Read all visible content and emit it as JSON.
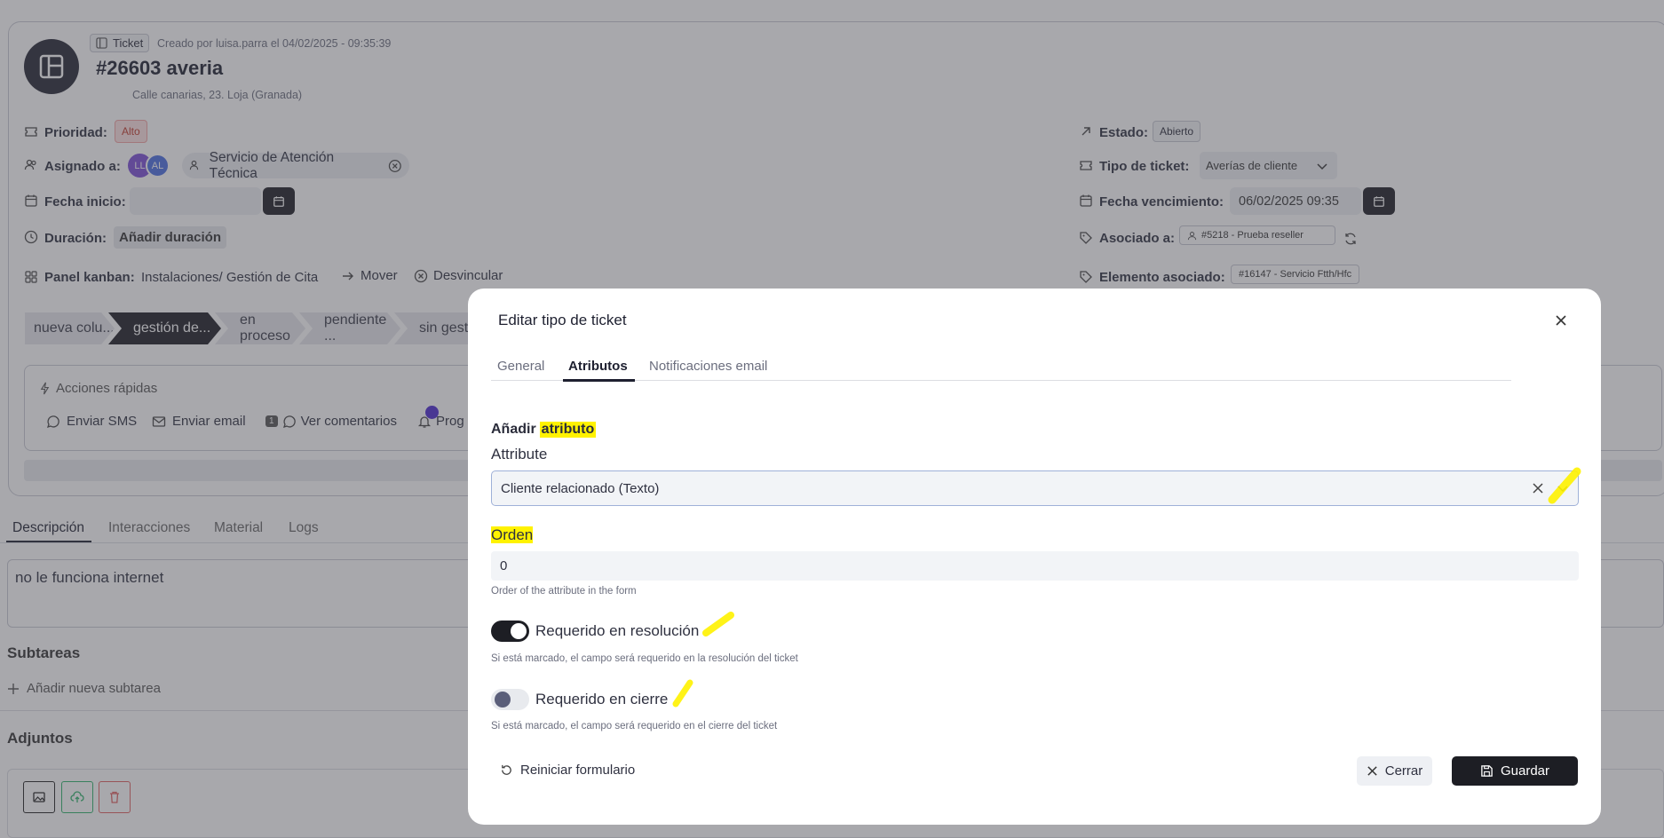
{
  "ticket": {
    "type_badge": "Ticket",
    "created_by": "Creado por luisa.parra el 04/02/2025 - 09:35:39",
    "title": "#26603 averia",
    "address": "Calle canarias, 23. Loja (Granada)",
    "priority_label": "Prioridad:",
    "priority_value": "Alto",
    "assigned_label": "Asignado a:",
    "avatar1": "LL",
    "avatar2": "AL",
    "assigned_group": "Servicio de Atención Técnica",
    "start_label": "Fecha inicio:",
    "duration_label": "Duración:",
    "duration_value": "Añadir duración",
    "kanban_label": "Panel kanban:",
    "kanban_value": "Instalaciones/ Gestión de Cita",
    "move_label": "Mover",
    "unlink_label": "Desvincular",
    "status_label": "Estado:",
    "status_value": "Abierto",
    "type_label": "Tipo de ticket:",
    "type_value": "Averías de cliente",
    "due_label": "Fecha vencimiento:",
    "due_value": "06/02/2025 09:35",
    "associated_label": "Asociado a:",
    "associated_value": "#5218 - Prueba reseller",
    "element_label": "Elemento asociado:",
    "element_value": "#16147 - Servicio Ftth/Hfc"
  },
  "stages": [
    "nueva colu...",
    "gestión de...",
    "en proceso",
    "pendiente ...",
    "sin gestio"
  ],
  "quick_actions": {
    "title": "Acciones rápidas",
    "sms": "Enviar SMS",
    "email": "Enviar email",
    "comments_count": "1",
    "comments": "Ver comentarios",
    "prog": "Prog"
  },
  "detail_tabs": [
    "Descripción",
    "Interacciones",
    "Material",
    "Logs"
  ],
  "description": "no le funciona internet",
  "subtasks": {
    "title": "Subtareas",
    "add": "Añadir nueva subtarea"
  },
  "attachments": {
    "title": "Adjuntos"
  },
  "modal": {
    "title": "Editar tipo de ticket",
    "tabs": [
      "General",
      "Atributos",
      "Notificaciones email"
    ],
    "section_title_1": "Añadir",
    "section_title_2": "atributo",
    "attribute_label": "Attribute",
    "attribute_value": "Cliente relacionado (Texto)",
    "order_label": "Orden",
    "order_value": "0",
    "order_help": "Order of the attribute in the form",
    "toggle1_label": "Requerido en resolución",
    "toggle1_help": "Si está marcado, el campo será requerido en la resolución del ticket",
    "toggle2_label": "Requerido en cierre",
    "toggle2_help": "Si está marcado, el campo será requerido en el cierre del ticket",
    "reset": "Reiniciar formulario",
    "close": "Cerrar",
    "save": "Guardar"
  },
  "colors": {
    "accent": "#1d1e24",
    "highlight": "#fff200",
    "priority_bg": "#fde0e0",
    "avatar_ll": "#7b4fd6",
    "avatar_al": "#4a6ee0"
  }
}
